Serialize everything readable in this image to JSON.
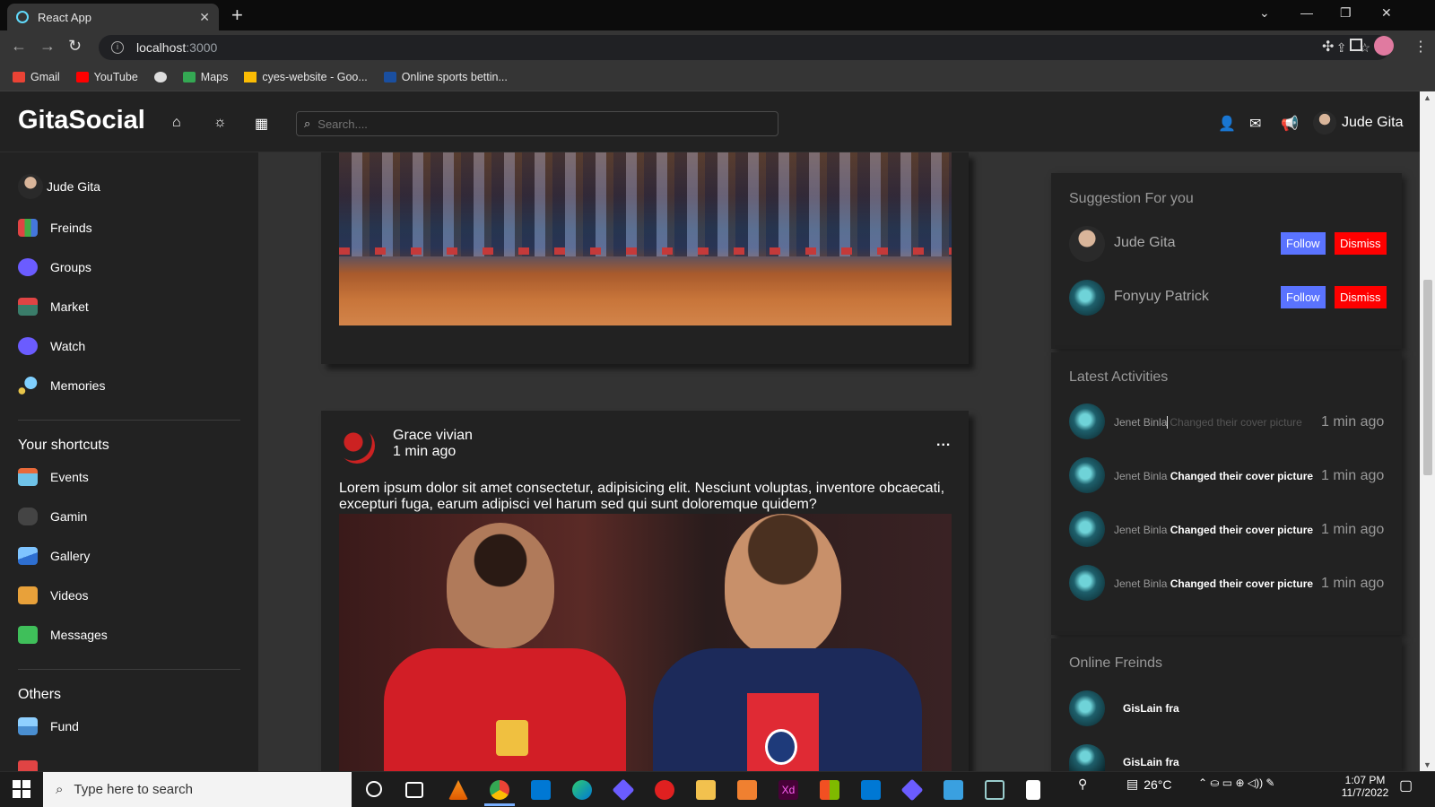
{
  "browser": {
    "tab_title": "React App",
    "url_host": "localhost",
    "url_port": ":3000",
    "bookmarks": [
      "Gmail",
      "YouTube",
      "",
      "Maps",
      "cyes-website - Goo...",
      "Online sports bettin..."
    ]
  },
  "app": {
    "logo": "GitaSocial",
    "search_placeholder": "Search....",
    "user_name": "Jude Gita"
  },
  "sidebar": {
    "user": "Jude Gita",
    "menu": [
      "Freinds",
      "Groups",
      "Market",
      "Watch",
      "Memories"
    ],
    "shortcuts_title": "Your shortcuts",
    "shortcuts": [
      "Events",
      "Gamin",
      "Gallery",
      "Videos",
      "Messages"
    ],
    "others_title": "Others",
    "others": [
      "Fund"
    ]
  },
  "post": {
    "author": "Grace vivian",
    "time": "1 min ago",
    "menu": "...",
    "text": "Lorem ipsum dolor sit amet consectetur, adipisicing elit. Nesciunt voluptas, inventore obcaecati, excepturi fuga, earum adipisci vel harum sed qui sunt doloremque quidem?"
  },
  "suggestions": {
    "title": "Suggestion For you",
    "follow": "Follow",
    "dismiss": "Dismiss",
    "users": [
      "Jude Gita",
      "Fonyuy Patrick"
    ]
  },
  "activities": {
    "title": "Latest Activities",
    "items": [
      {
        "name": "Jenet Binla",
        "action": "Changed their cover picture",
        "time": "1 min ago"
      },
      {
        "name": "Jenet Binla",
        "action": "Changed their cover picture",
        "time": "1 min ago"
      },
      {
        "name": "Jenet Binla",
        "action": "Changed their cover picture",
        "time": "1 min ago"
      },
      {
        "name": "Jenet Binla",
        "action": "Changed their cover picture",
        "time": "1 min ago"
      }
    ]
  },
  "online": {
    "title": "Online Freinds",
    "friends": [
      "GisLain fra",
      "GisLain fra"
    ]
  },
  "taskbar": {
    "search_placeholder": "Type here to search",
    "temperature": "26°C",
    "time": "1:07 PM",
    "date": "11/7/2022"
  },
  "colors": {
    "follow": "#5a73ff",
    "dismiss": "#ff0000",
    "background": "#333333",
    "panel": "#222222"
  }
}
